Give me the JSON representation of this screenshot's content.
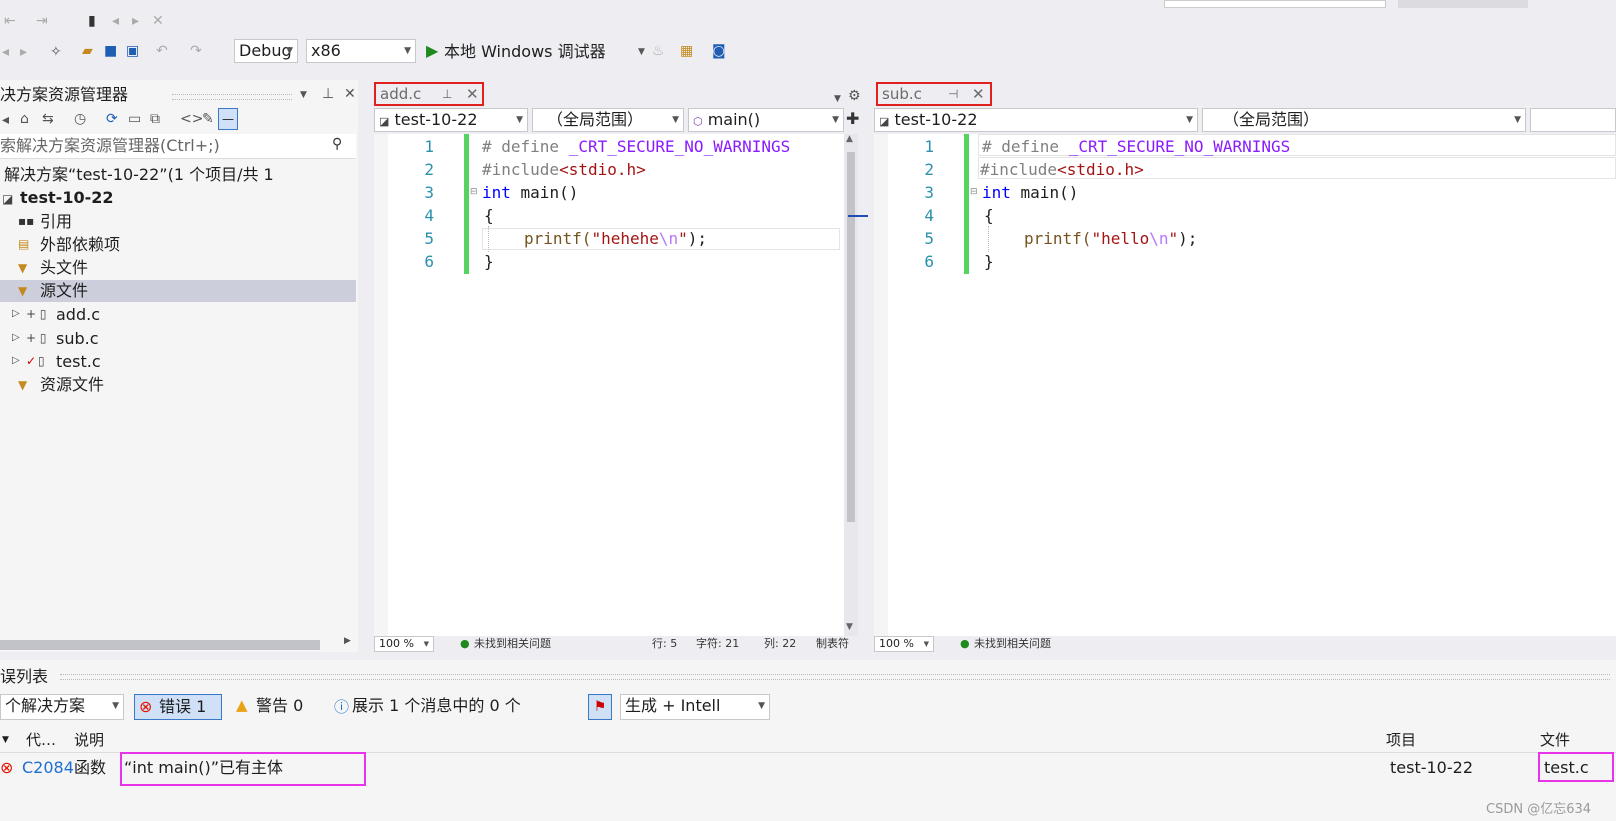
{
  "toolbar": {
    "config": "Debug",
    "platform": "x86",
    "run_label": "本地 Windows 调试器"
  },
  "solution_explorer": {
    "title": "决方案资源管理器",
    "search_placeholder": "索解决方案资源管理器(Ctrl+;)",
    "solution_line": "解决方案“test-10-22”(1 个项目/共 1",
    "project": "test-10-22",
    "items": [
      {
        "label": "引用"
      },
      {
        "label": "外部依赖项"
      },
      {
        "label": "头文件"
      },
      {
        "label": "源文件"
      },
      {
        "label": "add.c"
      },
      {
        "label": "sub.c"
      },
      {
        "label": "test.c"
      },
      {
        "label": "资源文件"
      }
    ]
  },
  "editor_left": {
    "tab": "add.c",
    "project_combo": "test-10-22",
    "scope_combo": "（全局范围）",
    "func_combo": "main()",
    "zoom": "100 %",
    "issues": "未找到相关问题",
    "row": "行: 5",
    "char": "字符: 21",
    "col": "列: 22",
    "tabs_mode": "制表符",
    "lines": [
      "1",
      "2",
      "3",
      "4",
      "5",
      "6"
    ],
    "code": {
      "l1_hash": "# define ",
      "l1_macro": "_CRT_SECURE_NO_WARNINGS",
      "l2_inc": "#include",
      "l2_hdr": "<stdio.h>",
      "l3_kw": "int",
      "l3_rest": " main()",
      "l4": "{",
      "l5_fn": "printf(",
      "l5_str1": "\"hehehe",
      "l5_esc": "\\n",
      "l5_str2": "\"",
      "l5_end": ");",
      "l6": "}"
    }
  },
  "editor_right": {
    "tab": "sub.c",
    "project_combo": "test-10-22",
    "scope_combo": "（全局范围）",
    "zoom": "100 %",
    "issues": "未找到相关问题",
    "lines": [
      "1",
      "2",
      "3",
      "4",
      "5",
      "6"
    ],
    "code": {
      "l1_hash": "# define ",
      "l1_macro": "_CRT_SECURE_NO_WARNINGS",
      "l2_inc": "#include",
      "l2_hdr": "<stdio.h>",
      "l3_kw": "int",
      "l3_rest": " main()",
      "l4": "{",
      "l5_fn": "printf(",
      "l5_str1": "\"hello",
      "l5_esc": "\\n",
      "l5_str2": "\"",
      "l5_end": ");",
      "l6": "}"
    }
  },
  "error_list": {
    "title": "误列表",
    "scope": "个解决方案",
    "errors_label": "错误 1",
    "warnings_label": "警告 0",
    "messages_label": "展示 1 个消息中的 0 个",
    "build_filter": "生成 + Intell",
    "col_code": "代…",
    "col_desc": "说明",
    "col_project": "项目",
    "col_file": "文件",
    "row": {
      "code": "C2084",
      "desc_prefix": "函数",
      "desc": "“int main()”已有主体",
      "project": "test-10-22",
      "file": "test.c"
    }
  },
  "watermark": "CSDN @亿忘634"
}
